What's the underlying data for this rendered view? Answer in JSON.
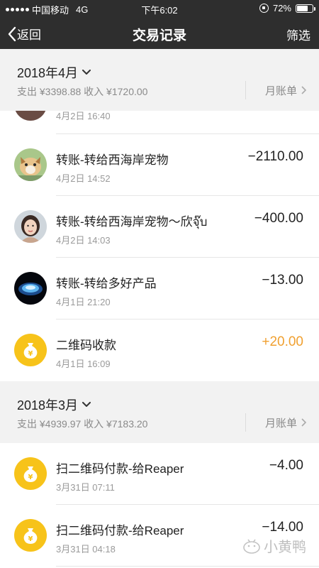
{
  "status_bar": {
    "carrier": "中国移动",
    "network": "4G",
    "time": "下午6:02",
    "battery": "72%",
    "battery_level": 0.72
  },
  "nav": {
    "back_label": "返回",
    "title": "交易记录",
    "filter_label": "筛选"
  },
  "sections": [
    {
      "month": "2018年4月",
      "summary": "支出 ¥3398.88 收入 ¥1720.00",
      "bill_label": "月账单",
      "partial_time": "4月2日 16:40",
      "transactions": [
        {
          "title": "转账-转给西海岸宠物",
          "time": "4月2日 14:52",
          "amount": "−2110.00"
        },
        {
          "title": "转账-转给西海岸宠物～欣จุ๊บ",
          "time": "4月2日 14:03",
          "amount": "−400.00"
        },
        {
          "title": "转账-转给多好产品",
          "time": "4月1日 21:20",
          "amount": "−13.00"
        },
        {
          "title": "二维码收款",
          "time": "4月1日 16:09",
          "amount": "+20.00"
        }
      ]
    },
    {
      "month": "2018年3月",
      "summary": "支出 ¥4939.97 收入 ¥7183.20",
      "bill_label": "月账单",
      "transactions": [
        {
          "title": "扫二维码付款-给Reaper",
          "time": "3月31日 07:11",
          "amount": "−4.00"
        },
        {
          "title": "扫二维码付款-给Reaper",
          "time": "3月31日 04:18",
          "amount": "−14.00"
        }
      ]
    }
  ],
  "watermark": "小黄鸭",
  "colors": {
    "nav_bg": "#2e2e2e",
    "section_bg": "#f2f2f2",
    "income": "#f0a030",
    "coin": "#f7c31a"
  }
}
